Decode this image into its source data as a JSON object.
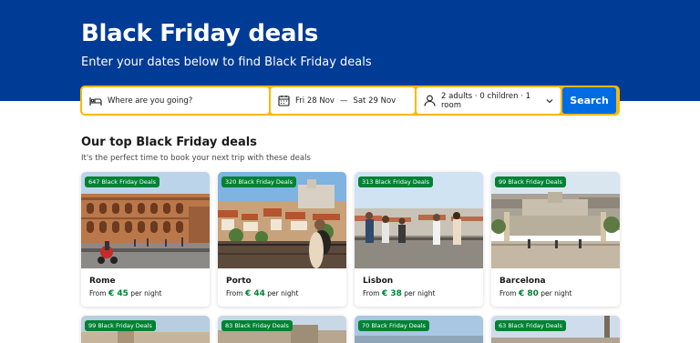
{
  "hero": {
    "title": "Black Friday deals",
    "subtitle": "Enter your dates below to find Black Friday deals"
  },
  "search": {
    "destination_placeholder": "Where are you going?",
    "check_in": "Fri 28 Nov",
    "date_separator": "—",
    "check_out": "Sat 29 Nov",
    "guests": "2 adults · 0 children · 1 room",
    "button": "Search"
  },
  "section": {
    "title": "Our top Black Friday deals",
    "subtitle": "It's the perfect time to book your next trip with these deals"
  },
  "deals": [
    {
      "badge": "647 Black Friday Deals",
      "city": "Rome",
      "price_prefix": "From",
      "price": "€ 45",
      "price_suffix": "per night"
    },
    {
      "badge": "320 Black Friday Deals",
      "city": "Porto",
      "price_prefix": "From",
      "price": "€ 44",
      "price_suffix": "per night"
    },
    {
      "badge": "313 Black Friday Deals",
      "city": "Lisbon",
      "price_prefix": "From",
      "price": "€ 38",
      "price_suffix": "per night"
    },
    {
      "badge": "99 Black Friday Deals",
      "city": "Barcelona",
      "price_prefix": "From",
      "price": "€ 80",
      "price_suffix": "per night"
    }
  ],
  "deals_row2": [
    {
      "badge": "99 Black Friday Deals"
    },
    {
      "badge": "83 Black Friday Deals"
    },
    {
      "badge": "70 Black Friday Deals"
    },
    {
      "badge": "63 Black Friday Deals"
    }
  ],
  "colors": {
    "hero_bg": "#003b95",
    "search_border": "#ffb700",
    "search_button": "#006ce4",
    "deal_green": "#008234"
  },
  "icons": {
    "destination": "bed-icon",
    "dates": "calendar-icon",
    "guests": "person-icon",
    "dropdown": "chevron-down-icon"
  }
}
